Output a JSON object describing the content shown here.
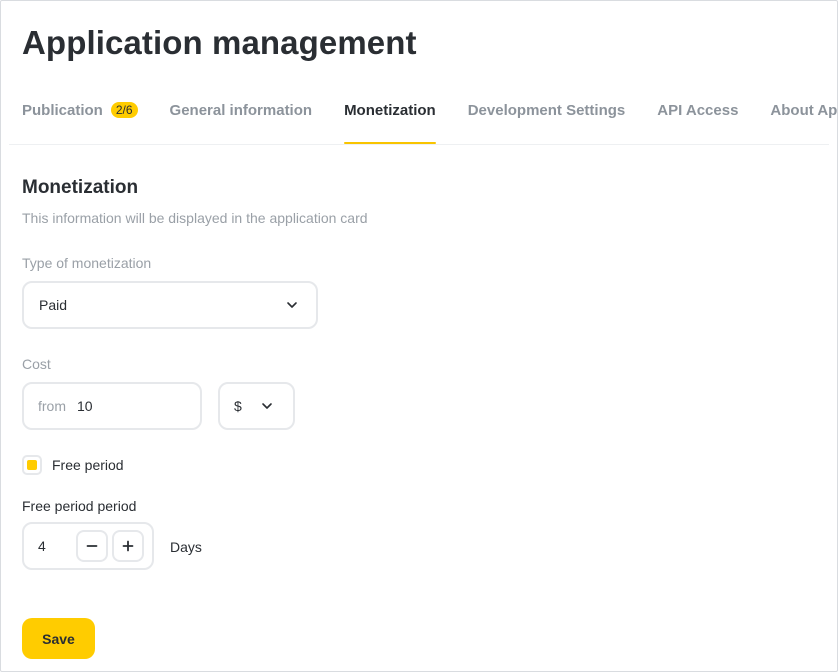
{
  "page": {
    "title": "Application management"
  },
  "tabs": [
    {
      "label": "Publication",
      "badge": "2/6",
      "active": false
    },
    {
      "label": "General information",
      "active": false
    },
    {
      "label": "Monetization",
      "active": true
    },
    {
      "label": "Development Settings",
      "active": false
    },
    {
      "label": "API Access",
      "active": false
    },
    {
      "label": "About App",
      "active": false
    }
  ],
  "section": {
    "title": "Monetization",
    "subtitle": "This information will be displayed in the application card"
  },
  "monetization_type": {
    "label": "Type of monetization",
    "value": "Paid",
    "icon": "chevron-down-icon"
  },
  "cost": {
    "label": "Cost",
    "prefix": "from",
    "value": "10",
    "currency": "$",
    "currency_icon": "chevron-down-icon"
  },
  "free_period": {
    "checkbox_label": "Free period",
    "checked": true,
    "period_label": "Free period period",
    "value": "4",
    "unit": "Days",
    "decrement_symbol": "−",
    "increment_symbol": "+"
  },
  "actions": {
    "save_label": "Save"
  },
  "colors": {
    "accent": "#ffcc00",
    "text_primary": "#2a2e33",
    "text_muted": "#9aa0a7",
    "border": "#e6e8eb"
  }
}
